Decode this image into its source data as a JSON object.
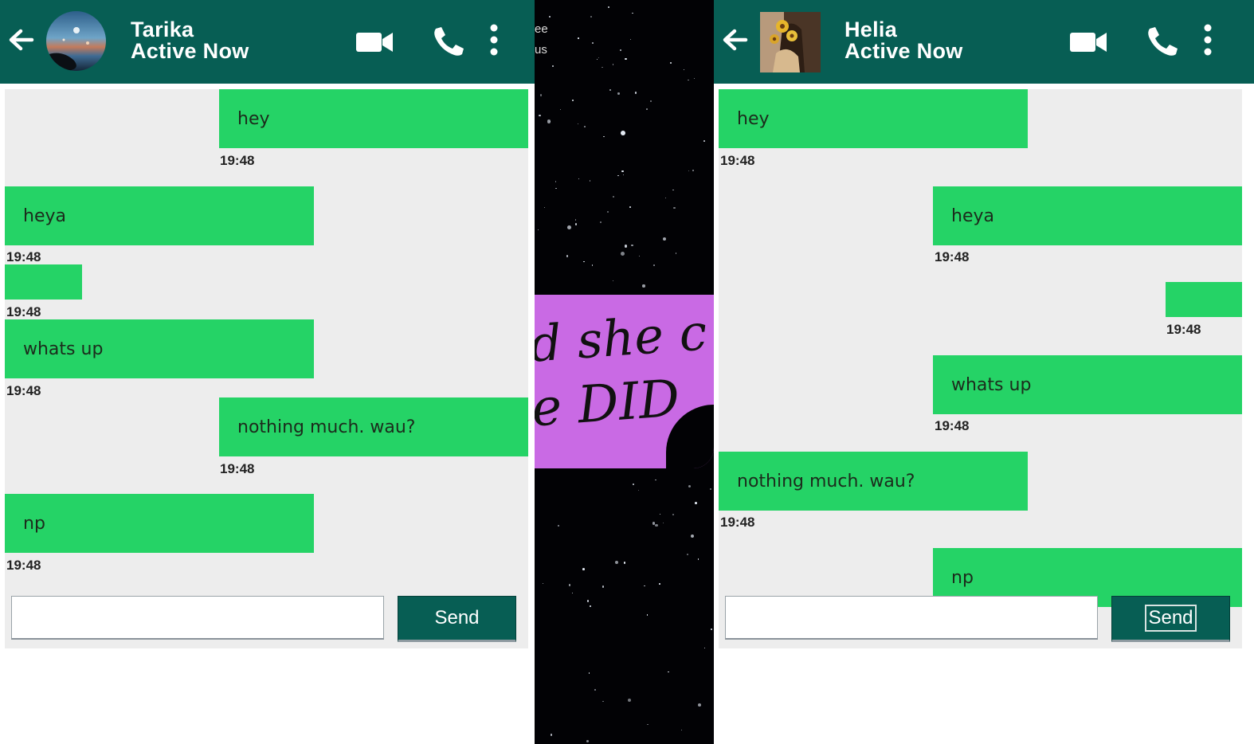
{
  "left_chat": {
    "contact_name": "Tarika",
    "status": "Active Now",
    "messages": [
      {
        "text": "hey",
        "time": "19:48",
        "side": "right"
      },
      {
        "text": "heya",
        "time": "19:48",
        "side": "left"
      },
      {
        "text": "",
        "time": "19:48",
        "side": "left"
      },
      {
        "text": "whats up",
        "time": "19:48",
        "side": "left"
      },
      {
        "text": "nothing much. wau?",
        "time": "19:48",
        "side": "right"
      },
      {
        "text": "np",
        "time": "19:48",
        "side": "left"
      }
    ],
    "input_value": "",
    "send_label": "Send"
  },
  "right_chat": {
    "contact_name": "Helia",
    "status": "Active Now",
    "messages": [
      {
        "text": "hey",
        "time": "19:48",
        "side": "left"
      },
      {
        "text": "heya",
        "time": "19:48",
        "side": "right"
      },
      {
        "text": "",
        "time": "19:48",
        "side": "right"
      },
      {
        "text": "whats up",
        "time": "19:48",
        "side": "right"
      },
      {
        "text": "nothing much. wau?",
        "time": "19:48",
        "side": "left"
      },
      {
        "text": "np",
        "time": "",
        "side": "right"
      }
    ],
    "input_value": "",
    "send_label": "Send"
  },
  "background": {
    "top_text_1": "ee",
    "top_text_2": "us",
    "quote_line_1": "d she c",
    "quote_line_2": "e DID"
  },
  "colors": {
    "header": "#075e54",
    "bubble": "#25d366",
    "chat_bg": "#ededed",
    "quote_card": "#c96ae4"
  },
  "icons": [
    "back-arrow-icon",
    "video-call-icon",
    "phone-icon",
    "more-vert-icon"
  ]
}
